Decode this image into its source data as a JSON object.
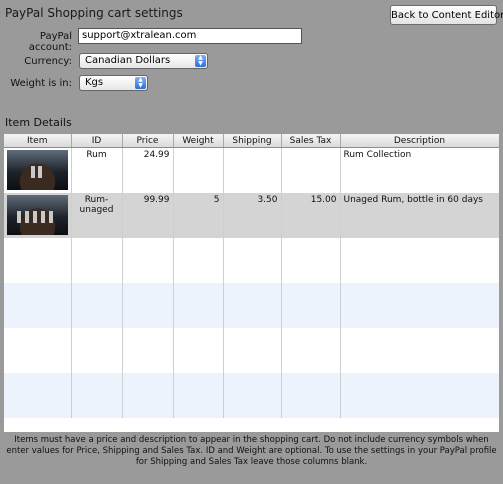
{
  "header": {
    "title": "PayPal Shopping cart settings",
    "back_button": "Back to Content Editor"
  },
  "form": {
    "account_label": "PayPal account:",
    "account_value": "support@xtralean.com",
    "currency_label": "Currency:",
    "currency_value": "Canadian Dollars",
    "weight_label": "Weight is in:",
    "weight_value": "Kgs"
  },
  "items": {
    "section_title": "Item Details",
    "columns": [
      "Item",
      "ID",
      "Price",
      "Weight",
      "Shipping",
      "Sales Tax",
      "Description"
    ],
    "rows": [
      {
        "image": "rum-bottles-photo",
        "id": "Rum",
        "price": "24.99",
        "weight": "",
        "shipping": "",
        "sales_tax": "",
        "description": "Rum Collection"
      },
      {
        "image": "rum-bottles-photo",
        "id": "Rum-unaged",
        "price": "99.99",
        "weight": "5",
        "shipping": "3.50",
        "sales_tax": "15.00",
        "description": "Unaged Rum, bottle in 60 days"
      }
    ]
  },
  "footer_note": "Items must have a price and description to appear in the shopping cart.  Do not include currency symbols when enter values for Price, Shipping and Sales Tax.  ID and Weight are optional.  To use the settings in your PayPal profile for Shipping and Sales Tax leave those columns blank.",
  "colors": {
    "background": "#9a9a9a",
    "row_alt": "#edf3fd",
    "row_selected": "#d4d4d4",
    "select_arrow": "#2f6fd6"
  }
}
